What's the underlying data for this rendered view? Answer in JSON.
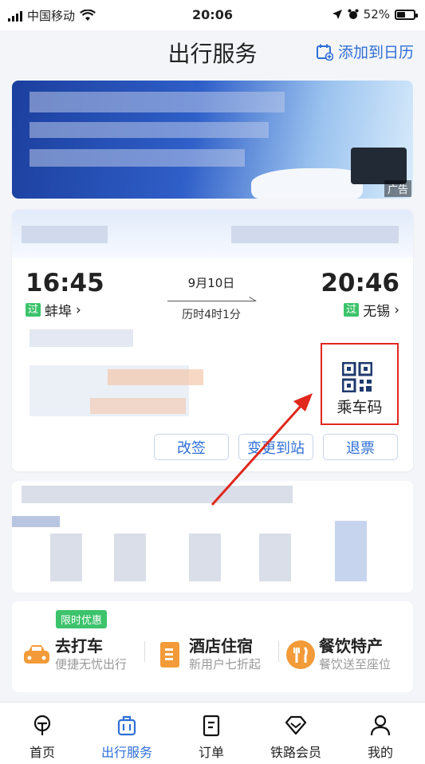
{
  "status_bar": {
    "carrier": "中国移动",
    "time": "20:06",
    "battery": "52%",
    "battery_level": 0.52
  },
  "header": {
    "title": "出行服务",
    "add_calendar": "添加到日历"
  },
  "banner": {
    "ad_tag": "广告"
  },
  "ticket": {
    "dep_time": "16:45",
    "dep_station": "蚌埠",
    "dep_chip": "过",
    "date": "9月10日",
    "duration": "历时4时1分",
    "arr_time": "20:46",
    "arr_station": "无锡",
    "arr_chip": "过",
    "chevron": "›",
    "qr_label": "乘车码",
    "buttons": [
      "改签",
      "变更到站",
      "退票"
    ]
  },
  "services": {
    "promo": "限时优惠",
    "items": [
      {
        "name": "去打车",
        "sub": "便捷无忧出行"
      },
      {
        "name": "酒店住宿",
        "sub": "新用户七折起"
      },
      {
        "name": "餐饮特产",
        "sub": "餐饮送至座位"
      }
    ]
  },
  "tabs": [
    {
      "label": "首页",
      "icon": "train-icon"
    },
    {
      "label": "出行服务",
      "icon": "luggage-icon"
    },
    {
      "label": "订单",
      "icon": "order-icon"
    },
    {
      "label": "铁路会员",
      "icon": "diamond-icon"
    },
    {
      "label": "我的",
      "icon": "user-icon"
    }
  ],
  "colors": {
    "accent": "#2f6fd6",
    "green": "#3cc36b",
    "red_annotation": "#e0281d",
    "orange": "#f29b38"
  }
}
